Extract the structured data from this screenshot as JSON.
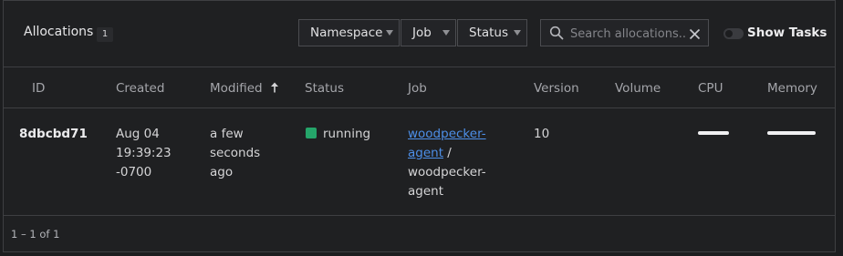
{
  "header": {
    "title": "Allocations",
    "count": "1"
  },
  "filters": {
    "namespace": "Namespace",
    "job": "Job",
    "status": "Status"
  },
  "search": {
    "placeholder": "Search allocations...",
    "value": ""
  },
  "show_tasks": {
    "label": "Show Tasks",
    "enabled": false
  },
  "table": {
    "columns": [
      "ID",
      "Created",
      "Modified",
      "Status",
      "Job",
      "Version",
      "Volume",
      "CPU",
      "Memory"
    ],
    "sorted_column": "Modified",
    "sort_direction": "ascending",
    "rows": [
      {
        "id": "8dbcbd71",
        "created_date": "Aug 04",
        "created_time": "19:39:23",
        "created_tz": "-0700",
        "modified_1": "a few",
        "modified_2": "seconds",
        "modified_3": "ago",
        "status": "running",
        "status_color": "#25a56a",
        "job_link_1": "woodpecker-",
        "job_link_2": "agent",
        "job_sep": " /",
        "task_group_1": "woodpecker-",
        "task_group_2": "agent",
        "version": "10",
        "volume": ""
      }
    ]
  },
  "pagination": {
    "summary": "1 – 1 of 1"
  }
}
